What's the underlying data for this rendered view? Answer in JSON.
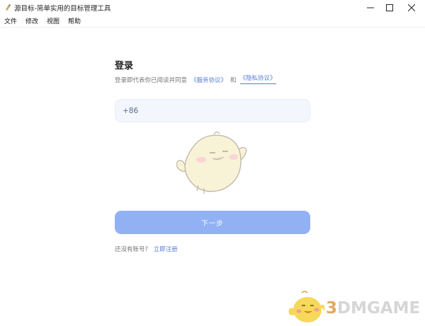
{
  "window": {
    "title": "源目标-简单实用的目标管理工具",
    "controls": [
      "minimize-icon",
      "maximize-icon",
      "close-icon"
    ]
  },
  "menu": [
    {
      "label": "文件"
    },
    {
      "label": "修改"
    },
    {
      "label": "视图"
    },
    {
      "label": "帮助"
    }
  ],
  "login": {
    "title": "登录",
    "agreement_prefix": "登录即代表你已阅读并同意",
    "terms_link": "《服务协议》",
    "and_text": "和",
    "privacy_link": "《隐私协议》",
    "country_code": "+86",
    "next_button": "下一步",
    "no_account_text": "还没有账号?",
    "register_link": "立即注册"
  },
  "watermark": {
    "number": "3",
    "text": "DMGAME"
  },
  "colors": {
    "accent": "#5a7bd6",
    "button": "#92b1f5",
    "input_bg": "#f3f7fd"
  }
}
